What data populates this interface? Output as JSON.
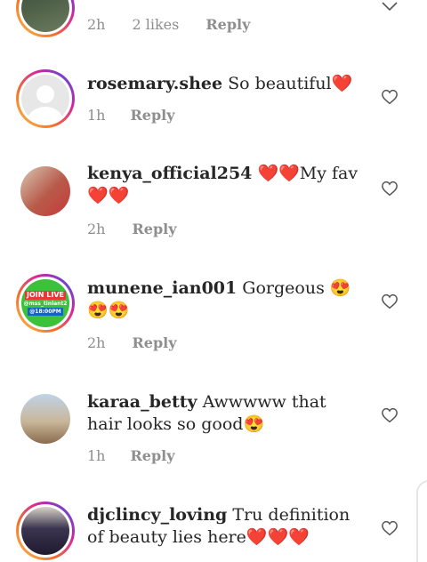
{
  "comments": [
    {
      "username": "",
      "text": "",
      "time": "2h",
      "likes": "2 likes",
      "reply": "Reply"
    },
    {
      "username": "rosemary.shee",
      "text": "So beautiful❤️",
      "time": "1h",
      "reply": "Reply"
    },
    {
      "username": "kenya_official254",
      "text": "❤️❤️My fav ❤️❤️",
      "time": "2h",
      "reply": "Reply"
    },
    {
      "username": "munene_ian001",
      "text": "Gorgeous 😍😍😍",
      "time": "2h",
      "reply": "Reply",
      "avatar_text": [
        "JOIN LIVE",
        "@mss_tinlant2",
        "@18:00PM"
      ]
    },
    {
      "username": "karaa_betty",
      "text": "Awwwww that hair looks so good😍",
      "time": "1h",
      "reply": "Reply"
    },
    {
      "username": "djclincy_loving",
      "text": "Tru definition of beauty lies here❤️❤️❤️",
      "time": "",
      "reply": ""
    }
  ],
  "colors": {
    "heart": "#e0245e",
    "muted": "#8e8e8e",
    "text": "#262626"
  },
  "icons": {
    "like": "heart-outline-icon",
    "collapse": "chevron-down-icon"
  }
}
